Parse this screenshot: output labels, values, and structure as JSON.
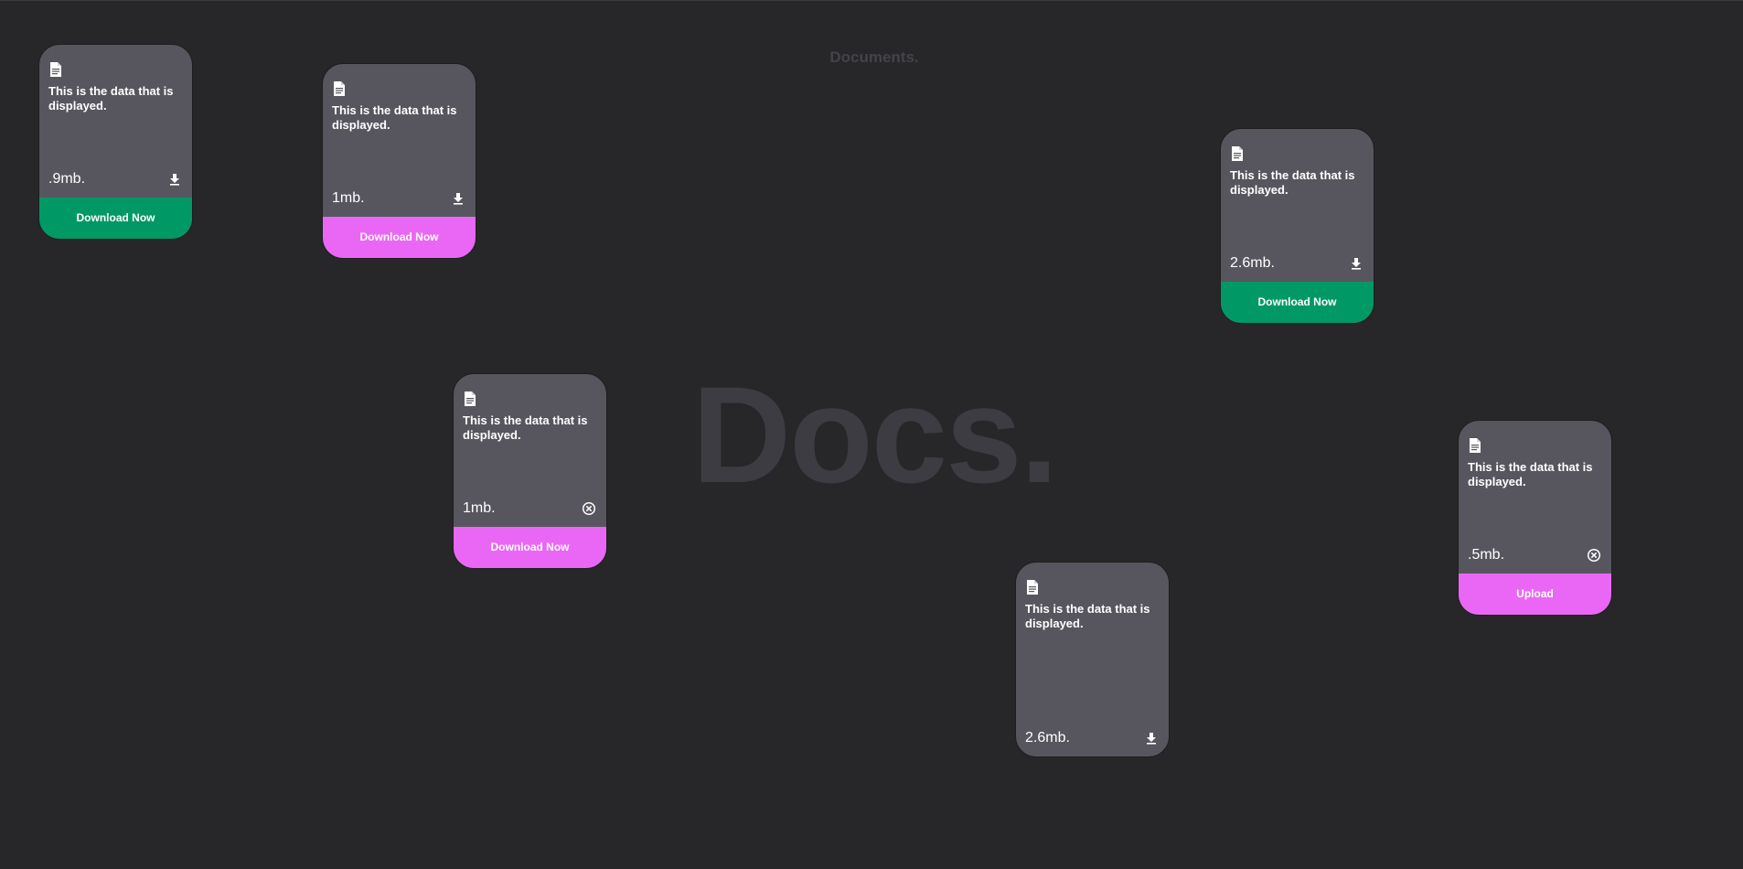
{
  "header": {
    "label": "Documents."
  },
  "hero": {
    "title": "Docs."
  },
  "colors": {
    "background": "#272729",
    "card": "#57565f",
    "green_button": "#009966",
    "pink_button": "#ea67f5",
    "muted_text": "#3c3c42"
  },
  "cards": [
    {
      "description": "This is the data that is displayed.",
      "size": ".9mb.",
      "action_icon": "download-icon",
      "button": "Download Now",
      "button_color": "green"
    },
    {
      "description": "This is the data that is displayed.",
      "size": "1mb.",
      "action_icon": "download-icon",
      "button": "Download Now",
      "button_color": "pink"
    },
    {
      "description": "This is the data that is displayed.",
      "size": "2.6mb.",
      "action_icon": "download-icon",
      "button": "Download Now",
      "button_color": "green"
    },
    {
      "description": "This is the data that is displayed.",
      "size": "1mb.",
      "action_icon": "cancel-icon",
      "button": "Download Now",
      "button_color": "pink"
    },
    {
      "description": "This is the data that is displayed.",
      "size": ".5mb.",
      "action_icon": "cancel-icon",
      "button": "Upload",
      "button_color": "pink"
    },
    {
      "description": "This is the data that is displayed.",
      "size": "2.6mb.",
      "action_icon": "download-icon",
      "button": "",
      "button_color": ""
    }
  ]
}
